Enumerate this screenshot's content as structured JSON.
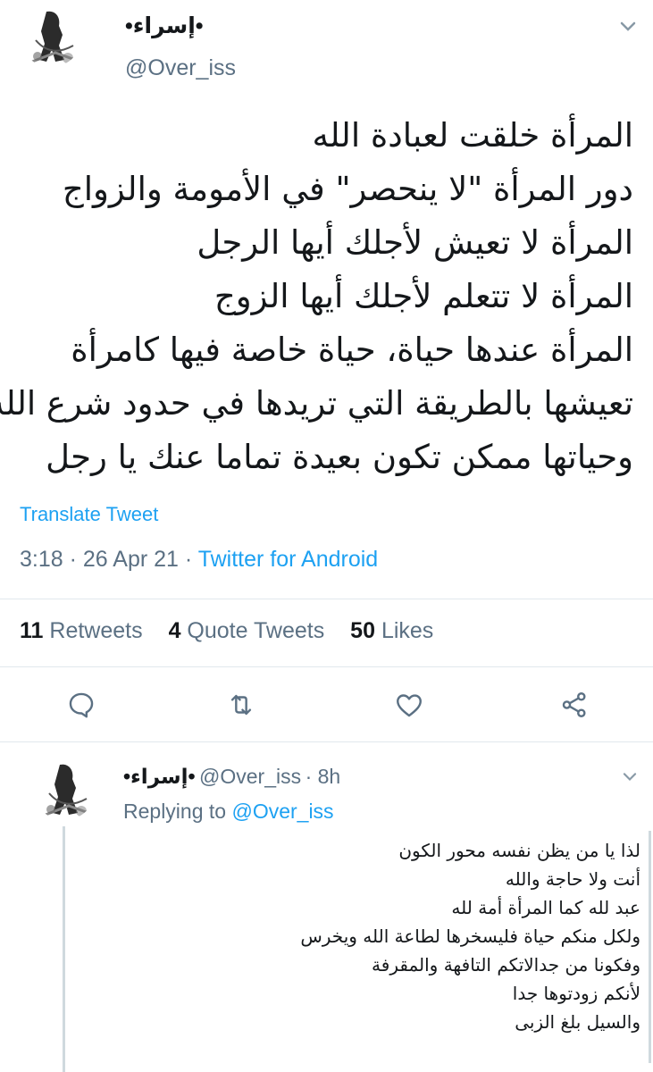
{
  "tweet": {
    "author_name": "•إسراء•",
    "author_handle": "@Over_iss",
    "lines": [
      "المرأة خلقت لعبادة الله",
      "دور المرأة \"لا ينحصر\" في الأمومة والزواج",
      "المرأة لا تعيش لأجلك أيها الرجل",
      "المرأة لا تتعلم لأجلك أيها الزوج",
      "المرأة عندها حياة، حياة خاصة فيها كامرأة",
      "تعيشها بالطريقة التي تريدها في حدود شرع الله",
      "وحياتها ممكن تكون بعيدة تماما عنك يا رجل"
    ],
    "translate_label": "Translate Tweet",
    "time": "3:18",
    "date": "26 Apr 21",
    "client": "Twitter for Android",
    "separator": "·",
    "retweets_count": "11",
    "retweets_label": "Retweets",
    "quotes_count": "4",
    "quotes_label": "Quote Tweets",
    "likes_count": "50",
    "likes_label": "Likes",
    "actions": [
      "reply-icon",
      "retweet-icon",
      "like-icon",
      "share-icon"
    ]
  },
  "reply": {
    "author_name": "•إسراء•",
    "author_handle": "@Over_iss",
    "age": "· 8h",
    "replying_prefix": "Replying to",
    "replying_to": "@Over_iss",
    "lines": [
      "لذا يا من يظن نفسه محور الكون",
      "أنت ولا حاجة والله",
      "عبد لله كما المرأة أمة لله",
      "ولكل منكم حياة فليسخرها لطاعة الله ويخرس",
      "وفكونا من جدالاتكم التافهة والمقرفة",
      "لأنكم زودتوها جدا",
      "والسيل بلغ الزبى"
    ]
  },
  "colors": {
    "accent": "#1da1f2",
    "secondary": "#5b7083",
    "divider": "#e1e8ed"
  }
}
